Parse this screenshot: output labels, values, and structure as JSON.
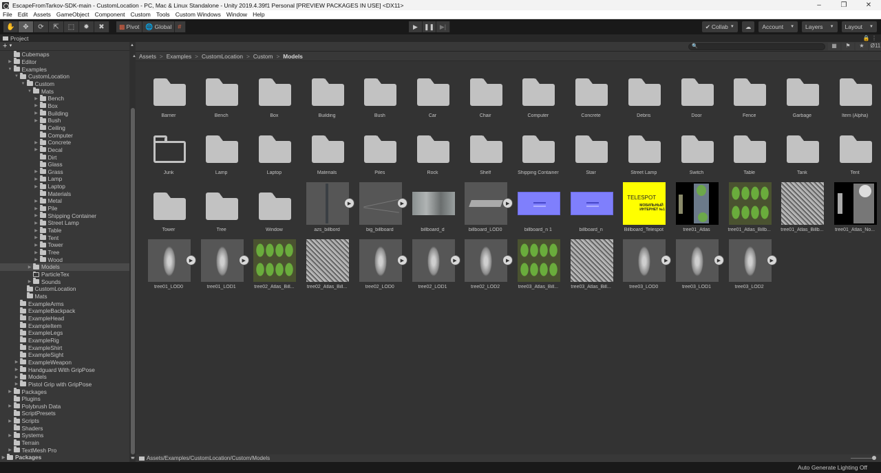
{
  "window": {
    "title": "EscapeFromTarkov-SDK-main - CustomLocation - PC, Mac & Linux Standalone - Unity 2019.4.39f1 Personal [PREVIEW PACKAGES IN USE] <DX11>",
    "controls": [
      "minimize",
      "maximize",
      "close"
    ]
  },
  "menubar": [
    "File",
    "Edit",
    "Assets",
    "GameObject",
    "Component",
    "Custom",
    "Tools",
    "Custom Windows",
    "Window",
    "Help"
  ],
  "toolbar": {
    "tools": [
      "hand-tool",
      "move-tool",
      "rotate-tool",
      "scale-tool",
      "rect-tool",
      "transform-tool",
      "custom-tool"
    ],
    "active_tool": "move-tool",
    "pivot_label": "Pivot",
    "global_label": "Global",
    "play_controls": [
      "play",
      "pause",
      "step"
    ],
    "collab_label": "Collab",
    "account_label": "Account",
    "layers_label": "Layers",
    "layout_label": "Layout"
  },
  "project_tab": {
    "title": "Project"
  },
  "tree": [
    {
      "label": "Cubemaps",
      "depth": 2,
      "arrow": "",
      "open": false
    },
    {
      "label": "Editor",
      "depth": 2,
      "arrow": "right",
      "open": false
    },
    {
      "label": "Examples",
      "depth": 2,
      "arrow": "down",
      "open": true
    },
    {
      "label": "CustomLocation",
      "depth": 3,
      "arrow": "down",
      "open": true
    },
    {
      "label": "Custom",
      "depth": 4,
      "arrow": "down",
      "open": true
    },
    {
      "label": "Mats",
      "depth": 5,
      "arrow": "down",
      "open": true
    },
    {
      "label": "Bench",
      "depth": 6,
      "arrow": "right"
    },
    {
      "label": "Box",
      "depth": 6,
      "arrow": "right"
    },
    {
      "label": "Building",
      "depth": 6,
      "arrow": "right"
    },
    {
      "label": "Bush",
      "depth": 6,
      "arrow": "right"
    },
    {
      "label": "Ceiling",
      "depth": 6,
      "arrow": ""
    },
    {
      "label": "Computer",
      "depth": 6,
      "arrow": ""
    },
    {
      "label": "Concrete",
      "depth": 6,
      "arrow": "right"
    },
    {
      "label": "Decal",
      "depth": 6,
      "arrow": "right"
    },
    {
      "label": "Dirt",
      "depth": 6,
      "arrow": ""
    },
    {
      "label": "Glass",
      "depth": 6,
      "arrow": ""
    },
    {
      "label": "Grass",
      "depth": 6,
      "arrow": "right"
    },
    {
      "label": "Lamp",
      "depth": 6,
      "arrow": "right"
    },
    {
      "label": "Laptop",
      "depth": 6,
      "arrow": "right"
    },
    {
      "label": "Materials",
      "depth": 6,
      "arrow": ""
    },
    {
      "label": "Metal",
      "depth": 6,
      "arrow": "right"
    },
    {
      "label": "Pile",
      "depth": 6,
      "arrow": "right"
    },
    {
      "label": "Shipping Container",
      "depth": 6,
      "arrow": "right"
    },
    {
      "label": "Street Lamp",
      "depth": 6,
      "arrow": "right"
    },
    {
      "label": "Table",
      "depth": 6,
      "arrow": "right"
    },
    {
      "label": "Tent",
      "depth": 6,
      "arrow": "right"
    },
    {
      "label": "Tower",
      "depth": 6,
      "arrow": "right"
    },
    {
      "label": "Tree",
      "depth": 6,
      "arrow": "right"
    },
    {
      "label": "Wood",
      "depth": 6,
      "arrow": "right"
    },
    {
      "label": "Models",
      "depth": 5,
      "arrow": "right",
      "selected": true
    },
    {
      "label": "ParticleTex",
      "depth": 5,
      "arrow": "",
      "empty": true
    },
    {
      "label": "Sounds",
      "depth": 5,
      "arrow": "right"
    },
    {
      "label": "CustomLocation",
      "depth": 4,
      "arrow": ""
    },
    {
      "label": "Mats",
      "depth": 4,
      "arrow": ""
    },
    {
      "label": "ExampleArms",
      "depth": 3,
      "arrow": ""
    },
    {
      "label": "ExampleBackpack",
      "depth": 3,
      "arrow": ""
    },
    {
      "label": "ExampleHead",
      "depth": 3,
      "arrow": ""
    },
    {
      "label": "ExampleItem",
      "depth": 3,
      "arrow": ""
    },
    {
      "label": "ExampleLegs",
      "depth": 3,
      "arrow": ""
    },
    {
      "label": "ExampleRig",
      "depth": 3,
      "arrow": ""
    },
    {
      "label": "ExampleShirt",
      "depth": 3,
      "arrow": ""
    },
    {
      "label": "ExampleSight",
      "depth": 3,
      "arrow": ""
    },
    {
      "label": "ExampleWeapon",
      "depth": 3,
      "arrow": "right"
    },
    {
      "label": "Handguard With GripPose",
      "depth": 3,
      "arrow": "right"
    },
    {
      "label": "Models",
      "depth": 3,
      "arrow": "right"
    },
    {
      "label": "Pistol Grip with GripPose",
      "depth": 3,
      "arrow": "right"
    },
    {
      "label": "Packages",
      "depth": 2,
      "arrow": "right"
    },
    {
      "label": "Plugins",
      "depth": 2,
      "arrow": ""
    },
    {
      "label": "Polybrush Data",
      "depth": 2,
      "arrow": "right"
    },
    {
      "label": "ScriptPresets",
      "depth": 2,
      "arrow": ""
    },
    {
      "label": "Scripts",
      "depth": 2,
      "arrow": "right"
    },
    {
      "label": "Shaders",
      "depth": 2,
      "arrow": ""
    },
    {
      "label": "Systems",
      "depth": 2,
      "arrow": "right"
    },
    {
      "label": "Terrain",
      "depth": 2,
      "arrow": ""
    },
    {
      "label": "TextMesh Pro",
      "depth": 2,
      "arrow": "right"
    },
    {
      "label": "Packages",
      "depth": 1,
      "arrow": "right",
      "bold": true
    }
  ],
  "search": {
    "placeholder": "",
    "hidden_count": "11"
  },
  "breadcrumb": [
    "Assets",
    "Examples",
    "CustomLocation",
    "Custom",
    "Models"
  ],
  "assets": [
    {
      "name": "Barrier",
      "type": "folder"
    },
    {
      "name": "Bench",
      "type": "folder"
    },
    {
      "name": "Box",
      "type": "folder"
    },
    {
      "name": "Building",
      "type": "folder"
    },
    {
      "name": "Bush",
      "type": "folder"
    },
    {
      "name": "Car",
      "type": "folder"
    },
    {
      "name": "Chair",
      "type": "folder"
    },
    {
      "name": "Computer",
      "type": "folder"
    },
    {
      "name": "Concrete",
      "type": "folder"
    },
    {
      "name": "Debris",
      "type": "folder"
    },
    {
      "name": "Door",
      "type": "folder"
    },
    {
      "name": "Fence",
      "type": "folder"
    },
    {
      "name": "Garbage",
      "type": "folder"
    },
    {
      "name": "Item (Alpha)",
      "type": "folder"
    },
    {
      "name": "Junk",
      "type": "folder-empty"
    },
    {
      "name": "Lamp",
      "type": "folder"
    },
    {
      "name": "Laptop",
      "type": "folder"
    },
    {
      "name": "Materials",
      "type": "folder"
    },
    {
      "name": "Piles",
      "type": "folder"
    },
    {
      "name": "Rock",
      "type": "folder"
    },
    {
      "name": "Shelf",
      "type": "folder"
    },
    {
      "name": "Shipping Container",
      "type": "folder"
    },
    {
      "name": "Stair",
      "type": "folder"
    },
    {
      "name": "Street Lamp",
      "type": "folder"
    },
    {
      "name": "Switch",
      "type": "folder"
    },
    {
      "name": "Table",
      "type": "folder"
    },
    {
      "name": "Tank",
      "type": "folder"
    },
    {
      "name": "Tent",
      "type": "folder"
    },
    {
      "name": "Tower",
      "type": "folder"
    },
    {
      "name": "Tree",
      "type": "folder"
    },
    {
      "name": "Window",
      "type": "folder"
    },
    {
      "name": "azs_billbord",
      "type": "model",
      "preview": "pole"
    },
    {
      "name": "big_billboard",
      "type": "model",
      "preview": "wire"
    },
    {
      "name": "billboard_d",
      "type": "texture",
      "preview": "gray-tex"
    },
    {
      "name": "billboard_LOD0",
      "type": "model",
      "preview": "panel"
    },
    {
      "name": "billboard_n 1",
      "type": "texture",
      "preview": "normal"
    },
    {
      "name": "billboard_n",
      "type": "texture",
      "preview": "normal"
    },
    {
      "name": "Billboard_Telespot",
      "type": "texture",
      "preview": "yellow",
      "preview_text": "TELESPOT"
    },
    {
      "name": "tree01_Atlas",
      "type": "texture",
      "preview": "atlas-dark"
    },
    {
      "name": "tree01_Atlas_Billb...",
      "type": "texture",
      "preview": "green-trees"
    },
    {
      "name": "tree01_Atlas_Billb...",
      "type": "texture",
      "preview": "gray-noise"
    },
    {
      "name": "tree01_Atlas_No...",
      "type": "texture",
      "preview": "atlas-bw"
    },
    {
      "name": "tree01_LOD0",
      "type": "model",
      "preview": "tree"
    },
    {
      "name": "tree01_LOD1",
      "type": "model",
      "preview": "tree"
    },
    {
      "name": "tree02_Atlas_Bill...",
      "type": "texture",
      "preview": "green-trees"
    },
    {
      "name": "tree02_Atlas_Bill...",
      "type": "texture",
      "preview": "gray-noise"
    },
    {
      "name": "tree02_LOD0",
      "type": "model",
      "preview": "tree"
    },
    {
      "name": "tree02_LOD1",
      "type": "model",
      "preview": "tree"
    },
    {
      "name": "tree02_LOD2",
      "type": "model",
      "preview": "tree"
    },
    {
      "name": "tree03_Atlas_Bill...",
      "type": "texture",
      "preview": "green-trees"
    },
    {
      "name": "tree03_Atlas_Bill...",
      "type": "texture",
      "preview": "gray-noise"
    },
    {
      "name": "tree03_LOD0",
      "type": "model",
      "preview": "tree"
    },
    {
      "name": "tree03_LOD1",
      "type": "model",
      "preview": "tree"
    },
    {
      "name": "tree03_LOD2",
      "type": "model",
      "preview": "tree"
    }
  ],
  "bottom_path": "Assets/Examples/CustomLocation/Custom/Models",
  "zoom_slider_value": 1.0,
  "status": "Auto Generate Lighting Off"
}
